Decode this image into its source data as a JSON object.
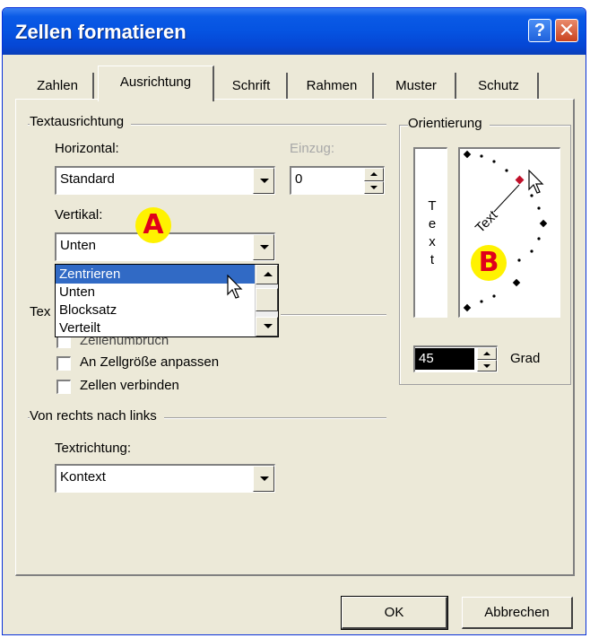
{
  "window": {
    "title": "Zellen formatieren",
    "help_label": "?",
    "close_label": "✕"
  },
  "tabs": [
    {
      "label": "Zahlen",
      "active": false
    },
    {
      "label": "Ausrichtung",
      "active": true
    },
    {
      "label": "Schrift",
      "active": false
    },
    {
      "label": "Rahmen",
      "active": false
    },
    {
      "label": "Muster",
      "active": false
    },
    {
      "label": "Schutz",
      "active": false
    }
  ],
  "text_alignment": {
    "group_label": "Textausrichtung",
    "horizontal_label": "Horizontal:",
    "horizontal_value": "Standard",
    "indent_label": "Einzug:",
    "indent_value": "0",
    "vertical_label": "Vertikal:",
    "vertical_value": "Unten",
    "vertical_options": [
      "Zentrieren",
      "Unten",
      "Blocksatz",
      "Verteilt"
    ],
    "vertical_highlighted": "Zentrieren"
  },
  "text_control": {
    "group_label_partial": "Tex",
    "wrap_label_partial": "Zeilenumbruch",
    "shrink_label": "An Zellgröße anpassen",
    "merge_label": "Zellen verbinden"
  },
  "rtl": {
    "group_label": "Von rechts nach links",
    "direction_label": "Textrichtung:",
    "direction_value": "Kontext"
  },
  "orientation": {
    "group_label": "Orientierung",
    "vertical_text": [
      "T",
      "e",
      "x",
      "t"
    ],
    "dial_text": "Text",
    "degrees_value": "45",
    "degrees_unit": "Grad"
  },
  "annotations": {
    "a": "A",
    "b": "B",
    "color_yellow": "#fff200",
    "color_red": "#e0001b"
  },
  "footer": {
    "ok_label": "OK",
    "cancel_label": "Abbrechen"
  }
}
